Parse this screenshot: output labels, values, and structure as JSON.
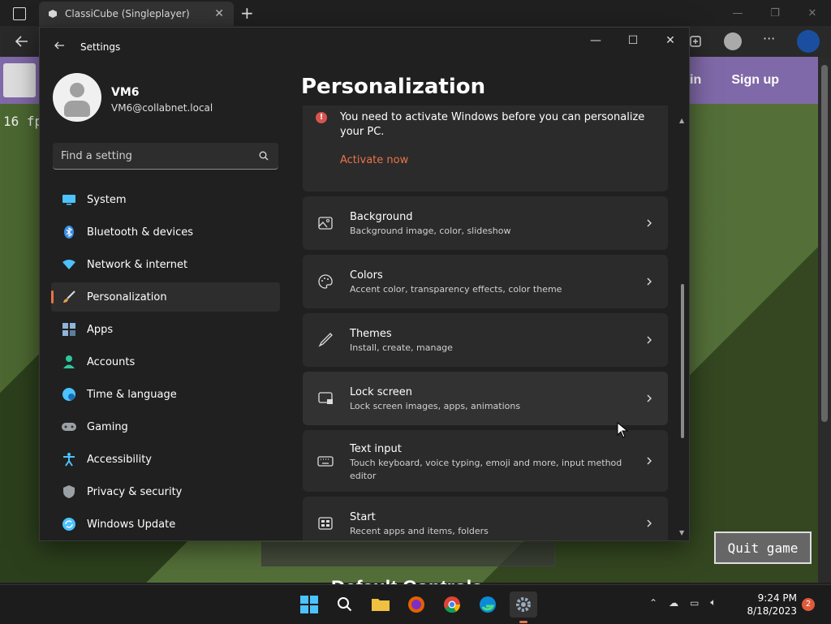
{
  "browser": {
    "tab_title": "ClassiCube (Singleplayer)",
    "tab_close": "✕",
    "new_tab": "+",
    "win_min": "—",
    "win_max": "❐",
    "win_close": "✕"
  },
  "game": {
    "fps": "16 fps",
    "signin": "in",
    "signup": "Sign up",
    "quit": "Quit game",
    "default_controls": "Default Controls"
  },
  "settings": {
    "window_title": "Settings",
    "ctrl_min": "—",
    "ctrl_max": "☐",
    "ctrl_close": "✕",
    "profile": {
      "name": "VM6",
      "email": "VM6@collabnet.local"
    },
    "search_placeholder": "Find a setting",
    "nav": [
      {
        "label": "System",
        "icon": "monitor-icon",
        "color": "#4cc2ff"
      },
      {
        "label": "Bluetooth & devices",
        "icon": "bluetooth-icon",
        "color": "#3a8ee6"
      },
      {
        "label": "Network & internet",
        "icon": "wifi-icon",
        "color": "#4cc2ff"
      },
      {
        "label": "Personalization",
        "icon": "brush-icon",
        "color": "#e8a04a",
        "active": true
      },
      {
        "label": "Apps",
        "icon": "apps-icon",
        "color": "#8fb4d9"
      },
      {
        "label": "Accounts",
        "icon": "person-icon",
        "color": "#2ec7a0"
      },
      {
        "label": "Time & language",
        "icon": "globe-clock-icon",
        "color": "#4cc2ff"
      },
      {
        "label": "Gaming",
        "icon": "gamepad-icon",
        "color": "#9aa0a6"
      },
      {
        "label": "Accessibility",
        "icon": "accessibility-icon",
        "color": "#4cc2ff"
      },
      {
        "label": "Privacy & security",
        "icon": "shield-icon",
        "color": "#9aa0a6"
      },
      {
        "label": "Windows Update",
        "icon": "update-icon",
        "color": "#4cc2ff"
      }
    ],
    "page_title": "Personalization",
    "activation": {
      "text": "You need to activate Windows before you can personalize your PC.",
      "link": "Activate now"
    },
    "cards": [
      {
        "title": "Background",
        "desc": "Background image, color, slideshow",
        "icon": "image-icon"
      },
      {
        "title": "Colors",
        "desc": "Accent color, transparency effects, color theme",
        "icon": "palette-icon"
      },
      {
        "title": "Themes",
        "desc": "Install, create, manage",
        "icon": "pen-icon"
      },
      {
        "title": "Lock screen",
        "desc": "Lock screen images, apps, animations",
        "icon": "lock-screen-icon"
      },
      {
        "title": "Text input",
        "desc": "Touch keyboard, voice typing, emoji and more, input method editor",
        "icon": "keyboard-icon"
      },
      {
        "title": "Start",
        "desc": "Recent apps and items, folders",
        "icon": "start-icon"
      }
    ]
  },
  "taskbar": {
    "time": "9:24 PM",
    "date": "8/18/2023",
    "notifications": "2"
  }
}
